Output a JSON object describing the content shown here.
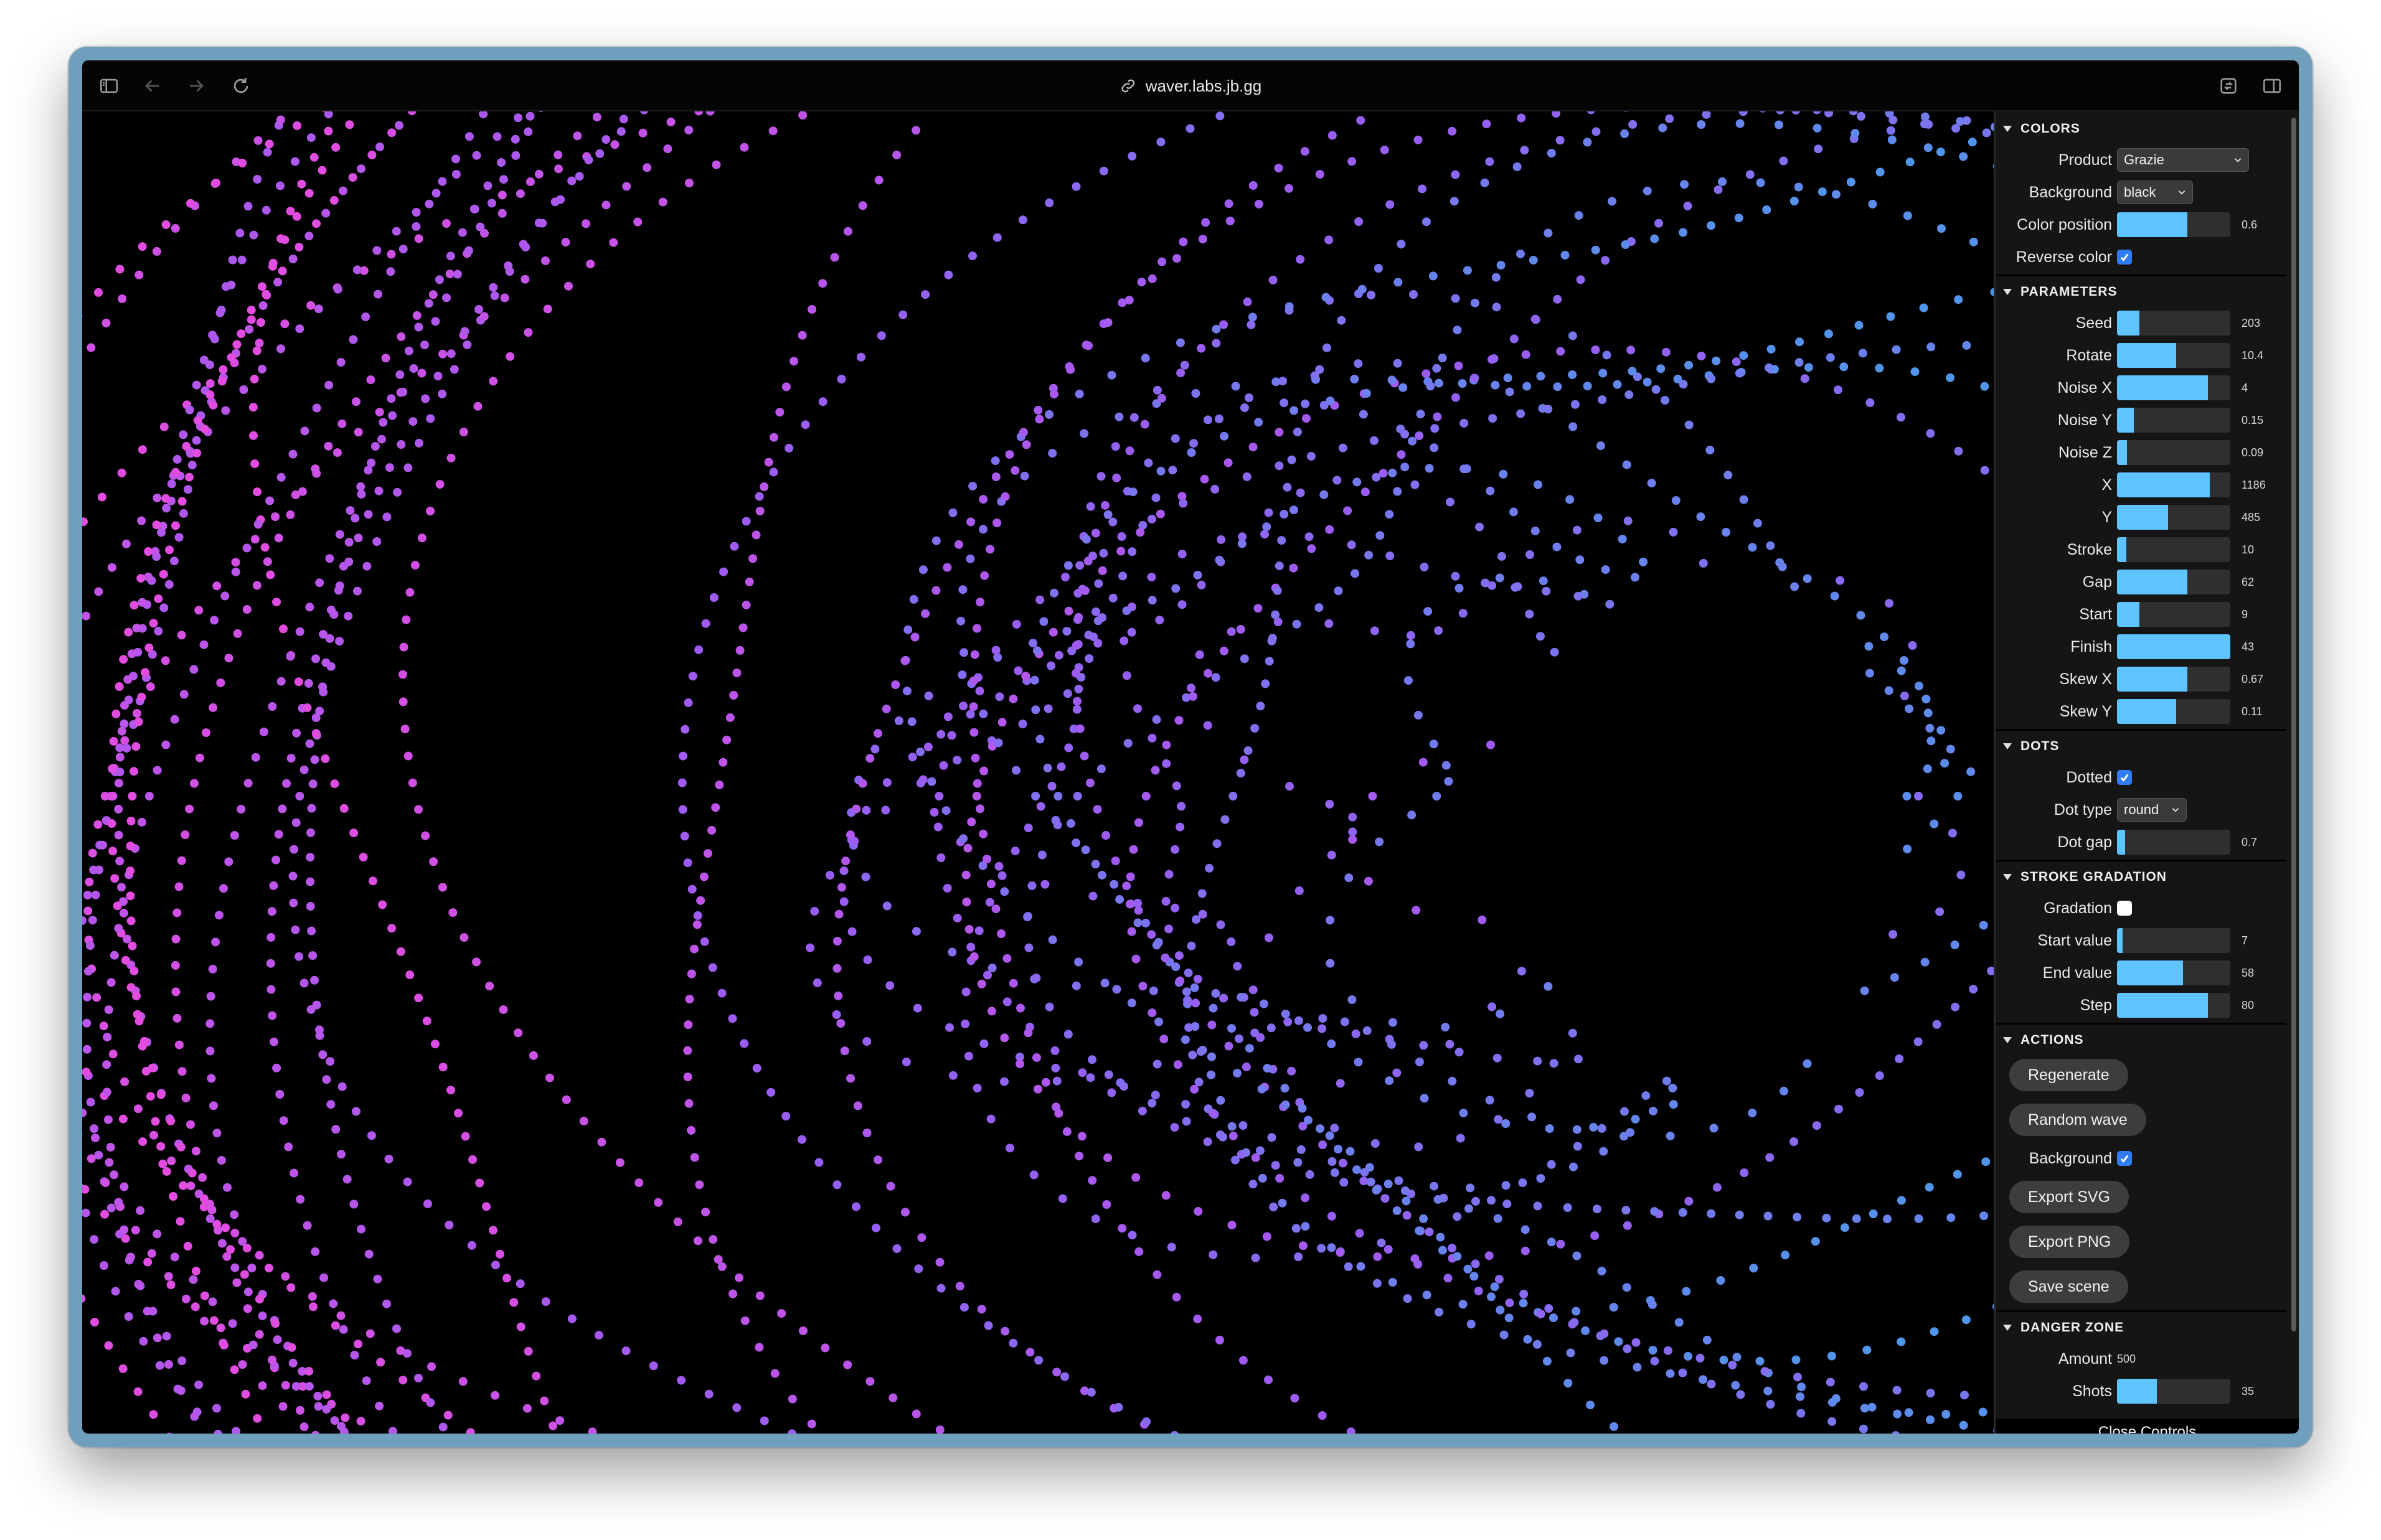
{
  "browser": {
    "url": "waver.labs.jb.gg"
  },
  "colors": {
    "title": "COLORS",
    "product_label": "Product",
    "product_value": "Grazie",
    "background_label": "Background",
    "background_value": "black",
    "color_position_label": "Color position",
    "color_position_value": "0.6",
    "color_position_level": 0.62,
    "reverse_color_label": "Reverse color",
    "reverse_color_checked": true
  },
  "parameters": {
    "title": "PARAMETERS",
    "items": [
      {
        "label": "Seed",
        "value": "203",
        "level": 0.2
      },
      {
        "label": "Rotate",
        "value": "10.4",
        "level": 0.52
      },
      {
        "label": "Noise X",
        "value": "4",
        "level": 0.8
      },
      {
        "label": "Noise Y",
        "value": "0.15",
        "level": 0.15
      },
      {
        "label": "Noise Z",
        "value": "0.09",
        "level": 0.09
      },
      {
        "label": "X",
        "value": "1186",
        "level": 0.82
      },
      {
        "label": "Y",
        "value": "485",
        "level": 0.45
      },
      {
        "label": "Stroke",
        "value": "10",
        "level": 0.08
      },
      {
        "label": "Gap",
        "value": "62",
        "level": 0.62
      },
      {
        "label": "Start",
        "value": "9",
        "level": 0.2
      },
      {
        "label": "Finish",
        "value": "43",
        "level": 1.0
      },
      {
        "label": "Skew X",
        "value": "0.67",
        "level": 0.62
      },
      {
        "label": "Skew Y",
        "value": "0.11",
        "level": 0.52
      }
    ]
  },
  "dots": {
    "title": "DOTS",
    "dotted_label": "Dotted",
    "dotted_checked": true,
    "dot_type_label": "Dot type",
    "dot_type_value": "round",
    "dot_gap_label": "Dot gap",
    "dot_gap_value": "0.7",
    "dot_gap_level": 0.07
  },
  "stroke_gradation": {
    "title": "STROKE GRADATION",
    "gradation_label": "Gradation",
    "gradation_checked": false,
    "items": [
      {
        "label": "Start value",
        "value": "7",
        "level": 0.05
      },
      {
        "label": "End value",
        "value": "58",
        "level": 0.58
      },
      {
        "label": "Step",
        "value": "80",
        "level": 0.8
      }
    ]
  },
  "actions": {
    "title": "ACTIONS",
    "regenerate": "Regenerate",
    "random_wave": "Random wave",
    "background_label": "Background",
    "background_checked": true,
    "export_svg": "Export SVG",
    "export_png": "Export PNG",
    "save_scene": "Save scene"
  },
  "danger_zone": {
    "title": "DANGER ZONE",
    "amount_label": "Amount",
    "amount_value": "500",
    "shots_label": "Shots",
    "shots_value": "35",
    "shots_level": 0.35
  },
  "close_controls": "Close Controls",
  "theme": {
    "accent": "#5ec3ff",
    "checkbox": "#2f7cf6",
    "dot_pink": "#e24ce0",
    "dot_violet": "#9a5cf2",
    "dot_blue": "#4f96ea"
  },
  "icons": [
    "sidebar-icon",
    "back-arrow-icon",
    "forward-arrow-icon",
    "reload-icon",
    "link-icon",
    "share-icon",
    "split-view-icon"
  ]
}
